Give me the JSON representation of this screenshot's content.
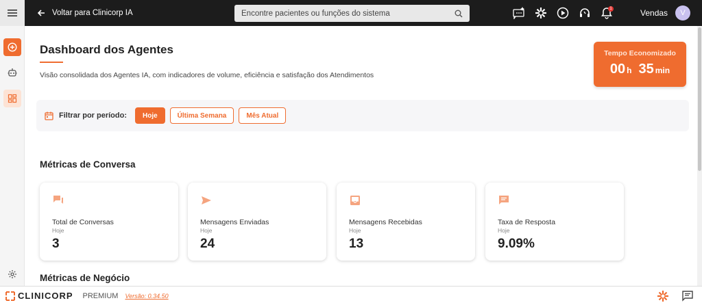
{
  "topbar": {
    "back_label": "Voltar para Clinicorp IA",
    "search_placeholder": "Encontre pacientes ou funções do sistema",
    "notification_count": "1",
    "user_name": "Vendas",
    "avatar_initial": "V"
  },
  "header": {
    "title": "Dashboard dos Agentes",
    "subtitle": "Visão consolidada dos Agentes IA, com indicadores de volume, eficiência e satisfação dos Atendimentos"
  },
  "time_saved": {
    "label": "Tempo Economizado",
    "hours": "00",
    "hours_unit": "h",
    "minutes": "35",
    "minutes_unit": "min"
  },
  "filter": {
    "label": "Filtrar por período:",
    "options": [
      "Hoje",
      "Última Semana",
      "Mês Atual"
    ],
    "selected": "Hoje"
  },
  "sections": {
    "conversation": "Métricas de Conversa",
    "business": "Métricas de Negócio"
  },
  "cards": [
    {
      "icon": "forum-icon",
      "title": "Total de Conversas",
      "period": "Hoje",
      "value": "3"
    },
    {
      "icon": "send-icon",
      "title": "Mensagens Enviadas",
      "period": "Hoje",
      "value": "24"
    },
    {
      "icon": "inbox-icon",
      "title": "Mensagens Recebidas",
      "period": "Hoje",
      "value": "13"
    },
    {
      "icon": "chat-bubble-icon",
      "title": "Taxa de Resposta",
      "period": "Hoje",
      "value": "9.09%"
    }
  ],
  "footer": {
    "brand": "CLINICORP",
    "plan": "PREMIUM",
    "version": "Versão: 0.34.50"
  },
  "colors": {
    "accent": "#ef6c2f",
    "topbar": "#1c1c1c"
  }
}
